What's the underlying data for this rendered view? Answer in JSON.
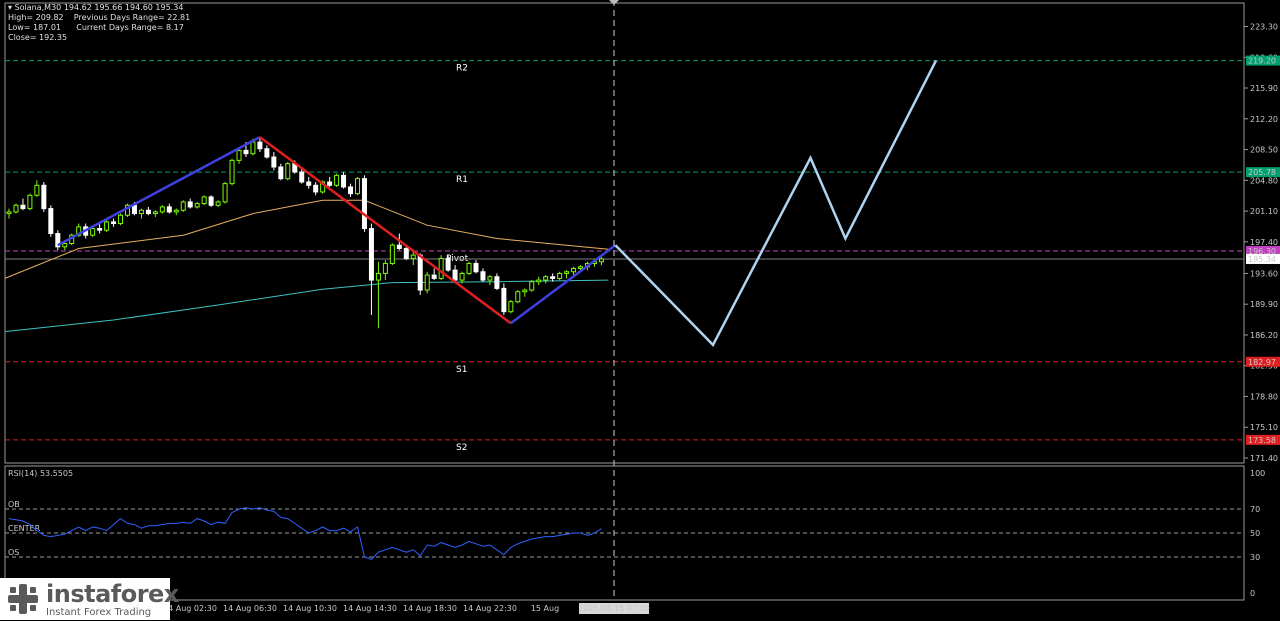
{
  "header": {
    "symbol": "Solana,M30",
    "ohlc": "194.62 195.66 194.60 195.34",
    "high": "High= 209.82",
    "low": "Low= 187.01",
    "close": "Close= 192.35",
    "prev_range": "Previous Days Range= 22.81",
    "cur_range": "Current Days Range= 8.17"
  },
  "logo": {
    "brand": "instaforex",
    "tagline": "Instant Forex Trading"
  },
  "colors": {
    "bg": "#000000",
    "bull": "#7CFC00",
    "bear": "#ffffff",
    "up_trend": "#4040e0",
    "down_trend": "#e02020",
    "projection": "#b0d4f0",
    "ma_fast": "#e8b060",
    "ma_slow": "#40c0c0",
    "resistance": "#00a070",
    "support": "#e02020",
    "pivot": "#c040c0"
  },
  "chart_data": [
    {
      "type": "candlestick",
      "title": "Solana,M30",
      "y_axis_ticks": [
        "223.30",
        "219.60",
        "215.90",
        "212.20",
        "208.50",
        "204.80",
        "201.10",
        "197.40",
        "193.60",
        "189.90",
        "186.20",
        "182.50",
        "178.80",
        "175.10",
        "171.40"
      ],
      "ylim": [
        170.6,
        225.4
      ],
      "x_tick_labels": [
        "14 Aug 02:30",
        "14 Aug 06:30",
        "14 Aug 10:30",
        "14 Aug 14:30",
        "14 Aug 18:30",
        "14 Aug 22:30",
        "15 Aug"
      ],
      "cursor_time_label": "2025.08.15 07:00",
      "levels": [
        {
          "name": "R2",
          "value": 219.2,
          "price_label": "219.20",
          "color": "#00a070"
        },
        {
          "name": "R1",
          "value": 205.78,
          "price_label": "205.78",
          "color": "#00a070"
        },
        {
          "name": "Pivot",
          "value": 196.3,
          "price_label": "196.30",
          "color": "#c040c0"
        },
        {
          "name": "",
          "value": 195.34,
          "price_label": "195.34",
          "color": "#808080"
        },
        {
          "name": "S1",
          "value": 182.97,
          "price_label": "182.97",
          "color": "#e02020"
        },
        {
          "name": "S2",
          "value": 173.58,
          "price_label": "173.58",
          "color": "#e02020"
        }
      ],
      "candles": [
        [
          200.8,
          201.4,
          200.2,
          201.0
        ],
        [
          201.0,
          202.0,
          200.8,
          201.8
        ],
        [
          201.8,
          202.6,
          201.2,
          201.4
        ],
        [
          201.4,
          203.2,
          201.2,
          203.0
        ],
        [
          203.0,
          204.8,
          202.8,
          204.2
        ],
        [
          204.2,
          204.6,
          201.0,
          201.4
        ],
        [
          201.4,
          201.8,
          198.0,
          198.4
        ],
        [
          198.4,
          198.8,
          196.4,
          196.8
        ],
        [
          196.8,
          197.6,
          196.4,
          197.2
        ],
        [
          197.2,
          198.4,
          197.0,
          198.2
        ],
        [
          198.2,
          199.6,
          198.0,
          199.2
        ],
        [
          199.2,
          199.6,
          197.8,
          198.2
        ],
        [
          198.2,
          199.4,
          198.0,
          199.0
        ],
        [
          199.0,
          199.6,
          198.4,
          198.8
        ],
        [
          198.8,
          200.0,
          198.6,
          199.8
        ],
        [
          199.8,
          200.2,
          199.2,
          199.6
        ],
        [
          199.6,
          200.8,
          199.4,
          200.6
        ],
        [
          200.6,
          202.0,
          200.4,
          201.8
        ],
        [
          201.8,
          202.2,
          200.6,
          200.8
        ],
        [
          200.8,
          201.4,
          200.2,
          201.2
        ],
        [
          201.2,
          201.6,
          200.6,
          200.8
        ],
        [
          200.8,
          201.2,
          200.4,
          201.0
        ],
        [
          201.0,
          201.8,
          200.8,
          201.6
        ],
        [
          201.6,
          202.0,
          200.8,
          201.0
        ],
        [
          201.0,
          201.4,
          200.6,
          201.2
        ],
        [
          201.2,
          202.4,
          201.0,
          202.2
        ],
        [
          202.2,
          202.6,
          201.4,
          201.6
        ],
        [
          201.6,
          202.2,
          201.4,
          202.0
        ],
        [
          202.0,
          203.0,
          201.8,
          202.8
        ],
        [
          202.8,
          203.0,
          201.6,
          201.8
        ],
        [
          201.8,
          202.4,
          201.6,
          202.2
        ],
        [
          202.2,
          204.6,
          202.0,
          204.4
        ],
        [
          204.4,
          207.4,
          204.2,
          207.2
        ],
        [
          207.2,
          208.6,
          206.8,
          208.4
        ],
        [
          208.4,
          209.4,
          207.6,
          208.0
        ],
        [
          208.0,
          209.8,
          207.8,
          209.4
        ],
        [
          209.4,
          209.82,
          208.2,
          208.6
        ],
        [
          208.6,
          209.0,
          207.4,
          207.6
        ],
        [
          207.6,
          208.2,
          206.0,
          206.4
        ],
        [
          206.4,
          206.8,
          204.8,
          205.0
        ],
        [
          205.0,
          207.0,
          204.8,
          206.8
        ],
        [
          206.8,
          207.2,
          205.6,
          205.8
        ],
        [
          205.8,
          206.2,
          204.4,
          204.6
        ],
        [
          204.6,
          205.2,
          203.8,
          204.2
        ],
        [
          204.2,
          204.6,
          203.0,
          203.4
        ],
        [
          203.4,
          204.8,
          203.2,
          204.6
        ],
        [
          204.6,
          205.2,
          204.0,
          204.2
        ],
        [
          204.2,
          205.6,
          204.0,
          205.4
        ],
        [
          205.4,
          205.8,
          203.8,
          204.0
        ],
        [
          204.0,
          204.4,
          202.8,
          203.2
        ],
        [
          203.2,
          205.2,
          203.0,
          205.0
        ],
        [
          205.0,
          205.4,
          198.6,
          199.0
        ],
        [
          199.0,
          199.6,
          188.6,
          192.8
        ],
        [
          192.8,
          195.0,
          187.01,
          193.6
        ],
        [
          193.6,
          195.2,
          192.8,
          194.8
        ],
        [
          194.8,
          197.2,
          194.6,
          197.0
        ],
        [
          197.0,
          198.4,
          196.4,
          196.6
        ],
        [
          196.6,
          197.0,
          195.2,
          195.4
        ],
        [
          195.4,
          196.2,
          194.6,
          195.8
        ],
        [
          195.8,
          196.0,
          191.0,
          191.6
        ],
        [
          191.6,
          193.8,
          191.2,
          193.4
        ],
        [
          193.4,
          194.2,
          192.8,
          193.0
        ],
        [
          193.0,
          195.8,
          192.8,
          195.4
        ],
        [
          195.4,
          195.8,
          193.8,
          194.0
        ],
        [
          194.0,
          194.6,
          192.4,
          192.8
        ],
        [
          192.8,
          193.8,
          192.4,
          193.6
        ],
        [
          193.6,
          195.0,
          193.4,
          194.8
        ],
        [
          194.8,
          195.2,
          193.6,
          193.8
        ],
        [
          193.8,
          194.2,
          192.6,
          192.8
        ],
        [
          192.8,
          193.4,
          192.2,
          193.2
        ],
        [
          193.2,
          193.6,
          191.6,
          191.8
        ],
        [
          191.8,
          192.4,
          188.6,
          189.0
        ],
        [
          189.0,
          190.4,
          188.8,
          190.2
        ],
        [
          190.2,
          191.6,
          190.0,
          191.4
        ],
        [
          191.4,
          191.8,
          190.8,
          191.6
        ],
        [
          191.6,
          192.8,
          191.4,
          192.6
        ],
        [
          192.6,
          193.2,
          192.2,
          192.8
        ],
        [
          192.8,
          193.4,
          192.4,
          193.2
        ],
        [
          193.2,
          193.6,
          192.6,
          193.0
        ],
        [
          193.0,
          193.8,
          192.8,
          193.6
        ],
        [
          193.6,
          194.0,
          193.0,
          193.8
        ],
        [
          193.8,
          194.4,
          193.4,
          194.2
        ],
        [
          194.2,
          194.6,
          193.8,
          194.4
        ],
        [
          194.4,
          195.0,
          194.0,
          194.8
        ],
        [
          194.8,
          195.4,
          194.4,
          195.0
        ],
        [
          195.0,
          195.66,
          194.6,
          195.34
        ]
      ],
      "ma_fast": [
        [
          0,
          193.0
        ],
        [
          10,
          196.6
        ],
        [
          25,
          198.2
        ],
        [
          35,
          200.8
        ],
        [
          45,
          202.4
        ],
        [
          51,
          202.4
        ],
        [
          60,
          199.4
        ],
        [
          70,
          197.8
        ],
        [
          86,
          196.5
        ]
      ],
      "ma_slow": [
        [
          0,
          186.6
        ],
        [
          15,
          188.0
        ],
        [
          30,
          189.8
        ],
        [
          45,
          191.7
        ],
        [
          55,
          192.5
        ],
        [
          70,
          192.6
        ],
        [
          86,
          192.8
        ]
      ],
      "trend_lines": [
        {
          "color": "up_trend",
          "points": [
            [
              7,
              197.0
            ],
            [
              36,
              210.0
            ]
          ]
        },
        {
          "color": "down_trend",
          "points": [
            [
              36,
              210.0
            ],
            [
              72,
              187.6
            ]
          ]
        },
        {
          "color": "up_trend",
          "points": [
            [
              72,
              187.6
            ],
            [
              87,
              197.0
            ]
          ]
        }
      ],
      "projection": [
        [
          87,
          197.0
        ],
        [
          101,
          185.0
        ],
        [
          115,
          207.5
        ],
        [
          120,
          197.8
        ],
        [
          133,
          219.2
        ]
      ]
    },
    {
      "type": "line",
      "title": "RSI(14) 53.5505",
      "y_axis_ticks": [
        "100",
        "70",
        "50",
        "30",
        "0"
      ],
      "ylim": [
        0,
        100
      ],
      "levels": [
        {
          "name": "OB",
          "value": 70
        },
        {
          "name": "CENTER",
          "value": 50
        },
        {
          "name": "OS",
          "value": 30
        }
      ],
      "values": [
        62,
        61,
        60,
        57,
        52,
        48,
        47,
        48,
        49,
        52,
        55,
        52,
        55,
        54,
        52,
        57,
        62,
        58,
        57,
        54,
        56,
        56,
        57,
        58,
        58,
        59,
        58,
        62,
        60,
        57,
        59,
        58,
        67,
        70,
        71,
        70,
        71,
        69,
        68,
        63,
        62,
        58,
        54,
        50,
        52,
        55,
        52,
        52,
        54,
        51,
        55,
        30,
        28,
        34,
        36,
        38,
        36,
        34,
        36,
        31,
        40,
        39,
        42,
        40,
        38,
        40,
        43,
        41,
        39,
        40,
        36,
        32,
        38,
        41,
        43,
        45,
        46,
        47,
        47,
        48,
        49,
        50,
        50,
        48,
        50,
        53.55
      ]
    }
  ]
}
